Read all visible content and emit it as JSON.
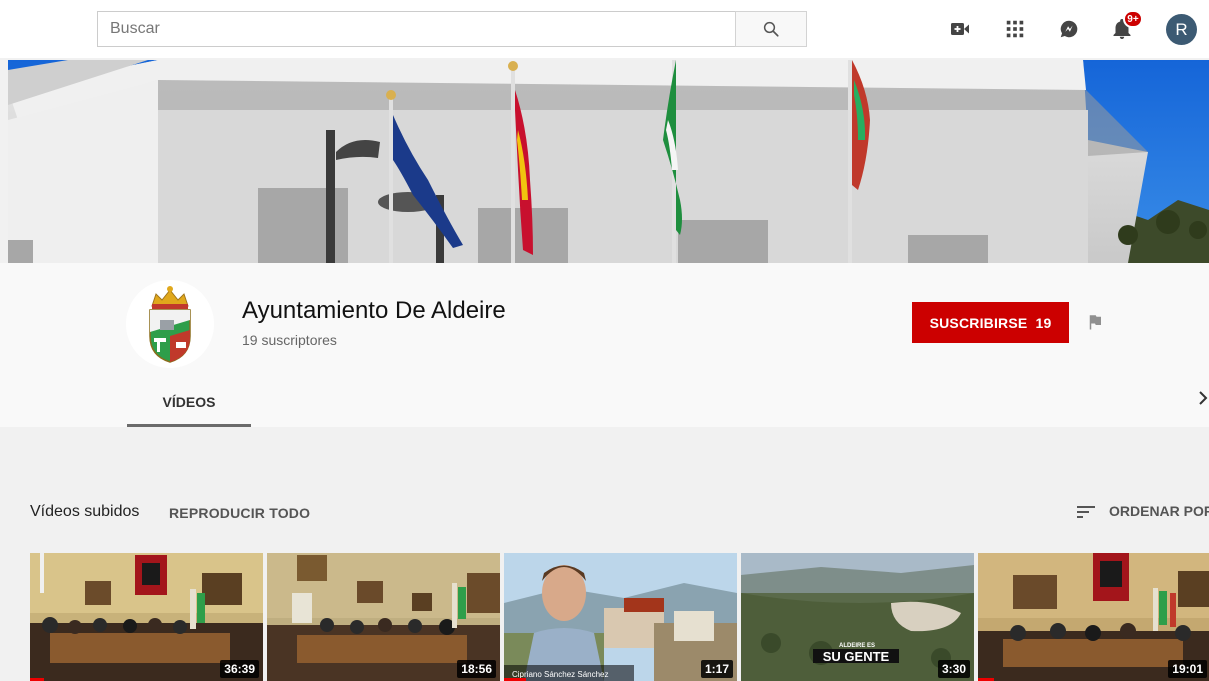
{
  "search": {
    "placeholder": "Buscar"
  },
  "header": {
    "notification_count": "9+",
    "avatar_letter": "R"
  },
  "channel": {
    "name": "Ayuntamiento De Aldeire",
    "subscribers_text": "19 suscriptores",
    "subscribe_label": "SUSCRIBIRSE",
    "subscribe_count": "19"
  },
  "tabs": [
    {
      "label": "VÍDEOS",
      "active": true
    }
  ],
  "section": {
    "title": "Vídeos subidos",
    "play_all": "REPRODUCIR TODO",
    "sort_label": "ORDENAR POR"
  },
  "videos": [
    {
      "duration": "36:39"
    },
    {
      "duration": "18:56"
    },
    {
      "duration": "1:17",
      "lower_third": "Cipriano Sánchez Sánchez"
    },
    {
      "duration": "3:30",
      "overlay_small": "ALDEIRE ES",
      "overlay_big": "SU GENTE"
    },
    {
      "duration": "19:01"
    }
  ],
  "colors": {
    "brand_red": "#cc0000",
    "background": "#f1f1f1",
    "header_bg": "#f9f9f9",
    "avatar": "#3c5a73"
  },
  "icons": [
    "search-icon",
    "video-camera-icon",
    "apps-grid-icon",
    "messages-icon",
    "bell-icon",
    "flag-icon",
    "chevron-right-icon",
    "sort-icon"
  ]
}
